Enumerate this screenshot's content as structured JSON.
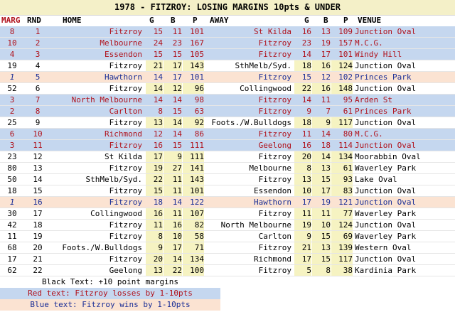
{
  "title": "1978 - FITZROY: LOSING MARGINS 10pts & UNDER",
  "headers": {
    "marg": "MARG",
    "rnd": "RND",
    "home": "HOME",
    "hg": "G",
    "hb": "B",
    "hp": "P",
    "away": "AWAY",
    "ag": "G",
    "ab": "B",
    "ap": "P",
    "venue": "VENUE"
  },
  "rows": [
    {
      "type": "loss",
      "marg": "8",
      "rnd": "1",
      "home": "Fitzroy",
      "hg": "15",
      "hb": "11",
      "hp": "101",
      "away": "St Kilda",
      "ag": "16",
      "ab": "13",
      "ap": "109",
      "venue": "Junction Oval"
    },
    {
      "type": "loss",
      "marg": "10",
      "rnd": "2",
      "home": "Melbourne",
      "hg": "24",
      "hb": "23",
      "hp": "167",
      "away": "Fitzroy",
      "ag": "23",
      "ab": "19",
      "ap": "157",
      "venue": "M.C.G."
    },
    {
      "type": "loss",
      "marg": "4",
      "rnd": "3",
      "home": "Essendon",
      "hg": "15",
      "hb": "15",
      "hp": "105",
      "away": "Fitzroy",
      "ag": "14",
      "ab": "17",
      "ap": "101",
      "venue": "Windy Hill"
    },
    {
      "type": "plain",
      "marg": "19",
      "rnd": "4",
      "home": "Fitzroy",
      "hg": "21",
      "hb": "17",
      "hp": "143",
      "away": "SthMelb/Syd.",
      "ag": "18",
      "ab": "16",
      "ap": "124",
      "venue": "Junction Oval"
    },
    {
      "type": "win",
      "marg": "1",
      "rnd": "5",
      "home": "Hawthorn",
      "hg": "14",
      "hb": "17",
      "hp": "101",
      "away": "Fitzroy",
      "ag": "15",
      "ab": "12",
      "ap": "102",
      "venue": "Princes Park"
    },
    {
      "type": "plain",
      "marg": "52",
      "rnd": "6",
      "home": "Fitzroy",
      "hg": "14",
      "hb": "12",
      "hp": "96",
      "away": "Collingwood",
      "ag": "22",
      "ab": "16",
      "ap": "148",
      "venue": "Junction Oval"
    },
    {
      "type": "loss",
      "marg": "3",
      "rnd": "7",
      "home": "North Melbourne",
      "hg": "14",
      "hb": "14",
      "hp": "98",
      "away": "Fitzroy",
      "ag": "14",
      "ab": "11",
      "ap": "95",
      "venue": "Arden St"
    },
    {
      "type": "loss",
      "marg": "2",
      "rnd": "8",
      "home": "Carlton",
      "hg": "8",
      "hb": "15",
      "hp": "63",
      "away": "Fitzroy",
      "ag": "9",
      "ab": "7",
      "ap": "61",
      "venue": "Princes Park"
    },
    {
      "type": "plain",
      "marg": "25",
      "rnd": "9",
      "home": "Fitzroy",
      "hg": "13",
      "hb": "14",
      "hp": "92",
      "away": "Foots./W.Bulldogs",
      "ag": "18",
      "ab": "9",
      "ap": "117",
      "venue": "Junction Oval"
    },
    {
      "type": "loss",
      "marg": "6",
      "rnd": "10",
      "home": "Richmond",
      "hg": "12",
      "hb": "14",
      "hp": "86",
      "away": "Fitzroy",
      "ag": "11",
      "ab": "14",
      "ap": "80",
      "venue": "M.C.G."
    },
    {
      "type": "loss",
      "marg": "3",
      "rnd": "11",
      "home": "Fitzroy",
      "hg": "16",
      "hb": "15",
      "hp": "111",
      "away": "Geelong",
      "ag": "16",
      "ab": "18",
      "ap": "114",
      "venue": "Junction Oval"
    },
    {
      "type": "plain",
      "marg": "23",
      "rnd": "12",
      "home": "St Kilda",
      "hg": "17",
      "hb": "9",
      "hp": "111",
      "away": "Fitzroy",
      "ag": "20",
      "ab": "14",
      "ap": "134",
      "venue": "Moorabbin Oval"
    },
    {
      "type": "plain",
      "marg": "80",
      "rnd": "13",
      "home": "Fitzroy",
      "hg": "19",
      "hb": "27",
      "hp": "141",
      "away": "Melbourne",
      "ag": "8",
      "ab": "13",
      "ap": "61",
      "venue": "Waverley Park"
    },
    {
      "type": "plain",
      "marg": "50",
      "rnd": "14",
      "home": "SthMelb/Syd.",
      "hg": "22",
      "hb": "11",
      "hp": "143",
      "away": "Fitzroy",
      "ag": "13",
      "ab": "15",
      "ap": "93",
      "venue": "Lake Oval"
    },
    {
      "type": "plain",
      "marg": "18",
      "rnd": "15",
      "home": "Fitzroy",
      "hg": "15",
      "hb": "11",
      "hp": "101",
      "away": "Essendon",
      "ag": "10",
      "ab": "17",
      "ap": "83",
      "venue": "Junction Oval"
    },
    {
      "type": "win",
      "marg": "1",
      "rnd": "16",
      "home": "Fitzroy",
      "hg": "18",
      "hb": "14",
      "hp": "122",
      "away": "Hawthorn",
      "ag": "17",
      "ab": "19",
      "ap": "121",
      "venue": "Junction Oval"
    },
    {
      "type": "plain",
      "marg": "30",
      "rnd": "17",
      "home": "Collingwood",
      "hg": "16",
      "hb": "11",
      "hp": "107",
      "away": "Fitzroy",
      "ag": "11",
      "ab": "11",
      "ap": "77",
      "venue": "Waverley Park"
    },
    {
      "type": "plain",
      "marg": "42",
      "rnd": "18",
      "home": "Fitzroy",
      "hg": "11",
      "hb": "16",
      "hp": "82",
      "away": "North Melbourne",
      "ag": "19",
      "ab": "10",
      "ap": "124",
      "venue": "Junction Oval"
    },
    {
      "type": "plain",
      "marg": "11",
      "rnd": "19",
      "home": "Fitzroy",
      "hg": "8",
      "hb": "10",
      "hp": "58",
      "away": "Carlton",
      "ag": "9",
      "ab": "15",
      "ap": "69",
      "venue": "Waverley Park"
    },
    {
      "type": "plain",
      "marg": "68",
      "rnd": "20",
      "home": "Foots./W.Bulldogs",
      "hg": "9",
      "hb": "17",
      "hp": "71",
      "away": "Fitzroy",
      "ag": "21",
      "ab": "13",
      "ap": "139",
      "venue": "Western Oval"
    },
    {
      "type": "plain",
      "marg": "17",
      "rnd": "21",
      "home": "Fitzroy",
      "hg": "20",
      "hb": "14",
      "hp": "134",
      "away": "Richmond",
      "ag": "17",
      "ab": "15",
      "ap": "117",
      "venue": "Junction Oval"
    },
    {
      "type": "plain",
      "marg": "62",
      "rnd": "22",
      "home": "Geelong",
      "hg": "13",
      "hb": "22",
      "hp": "100",
      "away": "Fitzroy",
      "ag": "5",
      "ab": "8",
      "ap": "38",
      "venue": "Kardinia Park"
    }
  ],
  "legend": {
    "black": "Black Text: +10 point margins",
    "red": "Red text: Fitzroy losses by 1-10pts",
    "blue": "Blue text: Fitzroy wins by 1-10pts"
  },
  "colors": {
    "loss_bg": "#c5d7ef",
    "loss_text": "#b0121c",
    "win_bg": "#fbe3d2",
    "win_text": "#1a2e96",
    "score_bg": "#f6f3c2",
    "title_bg": "#f4f0c8"
  }
}
